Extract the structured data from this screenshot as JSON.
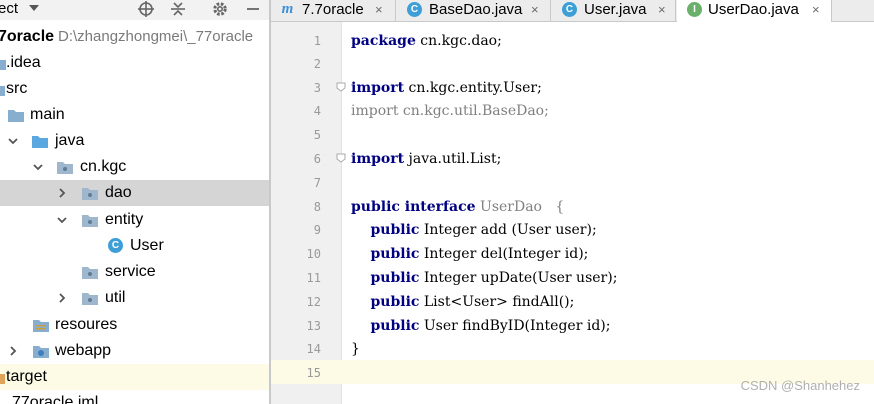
{
  "project_panel": {
    "title": "ect",
    "tree": [
      {
        "label": "7oracle",
        "path": "D:\\zhangzhongmei\\_77oracle",
        "icon": "module-folder-icon"
      },
      {
        "label": ".idea",
        "icon": "folder-icon"
      },
      {
        "label": "src",
        "icon": "folder-icon"
      },
      {
        "label": "main",
        "icon": "folder-icon"
      },
      {
        "label": "java",
        "icon": "source-folder-icon"
      },
      {
        "label": "cn.kgc",
        "icon": "package-icon"
      },
      {
        "label": "dao",
        "icon": "package-icon"
      },
      {
        "label": "entity",
        "icon": "package-icon"
      },
      {
        "label": "User",
        "icon": "class-icon"
      },
      {
        "label": "service",
        "icon": "package-icon"
      },
      {
        "label": "util",
        "icon": "package-icon"
      },
      {
        "label": "resoures",
        "icon": "resources-folder-icon"
      },
      {
        "label": "webapp",
        "icon": "web-folder-icon"
      },
      {
        "label": "target",
        "icon": "folder-icon"
      },
      {
        "label": "77oracle.iml",
        "icon": "iml-file-icon"
      }
    ]
  },
  "tabs": [
    {
      "label": "7.7oracle",
      "icon": "maven-m-icon",
      "close": "×"
    },
    {
      "label": "BaseDao.java",
      "icon": "class-c-icon",
      "close": "×"
    },
    {
      "label": "User.java",
      "icon": "class-c-icon",
      "close": "×"
    },
    {
      "label": "UserDao.java",
      "icon": "interface-i-icon",
      "close": "×",
      "active": true
    }
  ],
  "editor": {
    "lines": [
      {
        "n": "1",
        "kw": "package",
        "rest": " cn.kgc.dao;"
      },
      {
        "n": "2",
        "kw": "",
        "rest": ""
      },
      {
        "n": "3",
        "kw": "import",
        "rest": " cn.kgc.entity.User;"
      },
      {
        "n": "4",
        "kw": "",
        "rest": "import cn.kgc.util.BaseDao;"
      },
      {
        "n": "5",
        "kw": "",
        "rest": ""
      },
      {
        "n": "6",
        "kw": "import",
        "rest": " java.util.List;"
      },
      {
        "n": "7",
        "kw": "",
        "rest": ""
      },
      {
        "n": "8",
        "kw": "public interface",
        "rest": " UserDao   {"
      },
      {
        "n": "9",
        "kw": "    public",
        "rest": " Integer add (User user);"
      },
      {
        "n": "10",
        "kw": "    public",
        "rest": " Integer del(Integer id);"
      },
      {
        "n": "11",
        "kw": "    public",
        "rest": " Integer upDate(User user);"
      },
      {
        "n": "12",
        "kw": "    public",
        "rest": " List<User> findAll();"
      },
      {
        "n": "13",
        "kw": "    public",
        "rest": " User findByID(Integer id);"
      },
      {
        "n": "14",
        "kw": "",
        "rest": "}"
      },
      {
        "n": "15",
        "kw": "",
        "rest": ""
      }
    ]
  },
  "watermark": "CSDN @Shanhehez",
  "colors": {
    "keyword": "#000080",
    "selection": "#d5d5d5",
    "current_line": "#fdfbe6",
    "gutter": "#f0f0f0",
    "folder": "#87aecf",
    "class_icon": "#3d9fd6",
    "interface_icon": "#4aa74a"
  }
}
